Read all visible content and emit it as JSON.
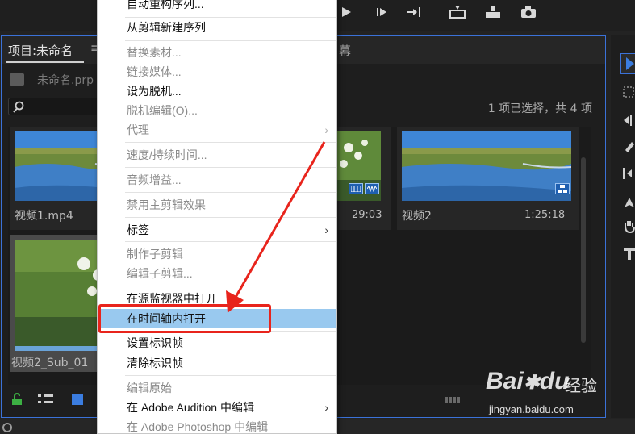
{
  "project_panel": {
    "title": "项目:未命名",
    "menu_glyph": "≡",
    "tab2_partial": "幕",
    "folder_name": "未命名.prp",
    "selection_status": "1 项已选择，共 4 项"
  },
  "clips": [
    {
      "name": "视频1.mp4",
      "duration": ""
    },
    {
      "name": "",
      "duration": "29:03"
    },
    {
      "name": "视频2",
      "duration": "1:25:18"
    },
    {
      "name": "视频2_Sub_01",
      "duration": ""
    }
  ],
  "context_menu": {
    "top_partial": "自动重构序列...",
    "items": [
      {
        "label": "从剪辑新建序列",
        "enabled": true
      },
      {
        "label": "替换素材...",
        "enabled": false
      },
      {
        "label": "链接媒体...",
        "enabled": false
      },
      {
        "label": "设为脱机...",
        "enabled": true
      },
      {
        "label": "脱机编辑(O)...",
        "enabled": false
      },
      {
        "label": "代理",
        "enabled": false,
        "submenu": true
      },
      {
        "label": "速度/持续时间...",
        "enabled": false
      },
      {
        "label": "音频增益...",
        "enabled": false
      },
      {
        "label": "禁用主剪辑效果",
        "enabled": false
      },
      {
        "label": "标签",
        "enabled": true,
        "submenu": true
      },
      {
        "label": "制作子剪辑",
        "enabled": false
      },
      {
        "label": "编辑子剪辑...",
        "enabled": false
      },
      {
        "label": "在源监视器中打开",
        "enabled": true
      },
      {
        "label": "在时间轴内打开",
        "enabled": true,
        "highlighted": true
      },
      {
        "label": "设置标识帧",
        "enabled": true
      },
      {
        "label": "清除标识帧",
        "enabled": true
      },
      {
        "label": "编辑原始",
        "enabled": false
      },
      {
        "label": "在 Adobe Audition 中编辑",
        "enabled": true,
        "submenu": true
      },
      {
        "label": "在 Adobe Photoshop 中编辑",
        "enabled": false
      }
    ]
  },
  "watermark": {
    "logo": "Bai",
    "logo_suffix": "du",
    "text": "经验",
    "url": "jingyan.baidu.com"
  },
  "colors": {
    "accent_border": "#3b72d9",
    "menu_highlight": "#99c9ef",
    "annotation_red": "#e8241c"
  }
}
